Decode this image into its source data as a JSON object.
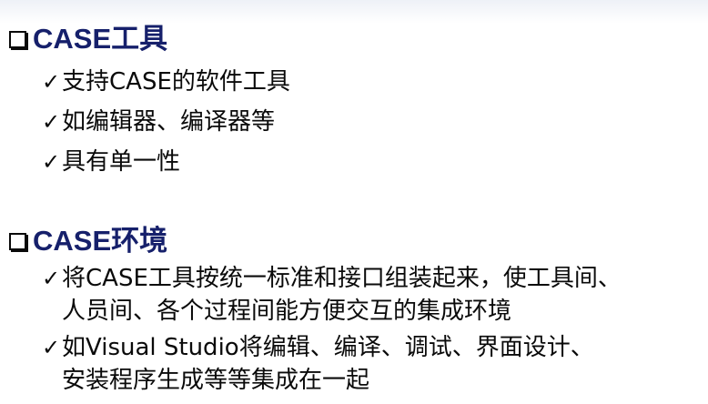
{
  "sections": [
    {
      "heading": "CASE工具",
      "items": [
        [
          "支持CASE的软件工具"
        ],
        [
          "如编辑器、编译器等"
        ],
        [
          "具有单一性"
        ]
      ]
    },
    {
      "heading": "CASE环境",
      "items": [
        [
          "将CASE工具按统一标准和接口组装起来，使工具间、",
          "人员间、各个过程间能方便交互的集成环境"
        ],
        [
          "如Visual Studio将编辑、编译、调试、界面设计、",
          "安装程序生成等等集成在一起"
        ]
      ]
    }
  ],
  "icons": {
    "heading_bullet": "checkbox-square-icon",
    "item_bullet": "checkmark-icon"
  },
  "colors": {
    "heading": "#16206b",
    "text": "#0a0a0a"
  }
}
